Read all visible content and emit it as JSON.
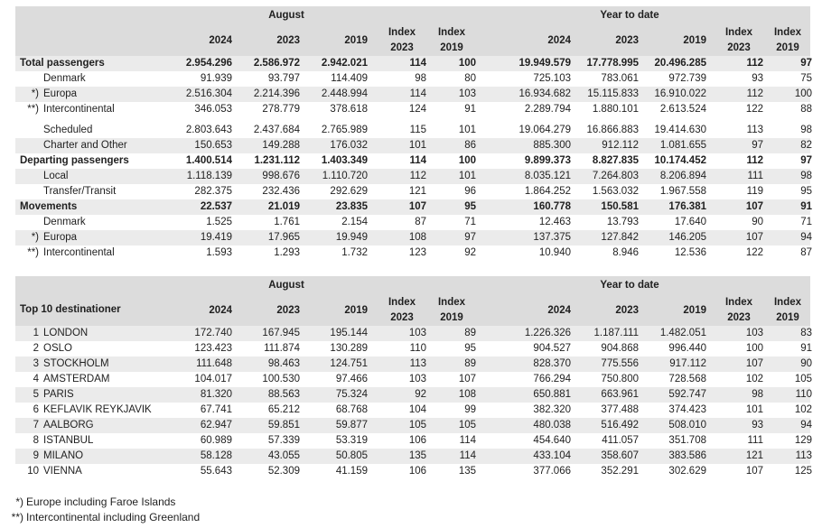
{
  "traffic": {
    "header": {
      "group_august": "August",
      "group_ytd": "Year to date",
      "col_2024": "2024",
      "col_2023": "2023",
      "col_2019": "2019",
      "index_label": "Index",
      "index_2023": "2023",
      "index_2019": "2019"
    },
    "rows": [
      {
        "label": "Total passengers",
        "mark": "",
        "bold": true,
        "shade": true,
        "aug": [
          "2.954.296",
          "2.586.972",
          "2.942.021",
          "114",
          "100"
        ],
        "ytd": [
          "19.949.579",
          "17.778.995",
          "20.496.285",
          "112",
          "97"
        ]
      },
      {
        "label": "Denmark",
        "mark": "",
        "bold": false,
        "shade": false,
        "aug": [
          "91.939",
          "93.797",
          "114.409",
          "98",
          "80"
        ],
        "ytd": [
          "725.103",
          "783.061",
          "972.739",
          "93",
          "75"
        ]
      },
      {
        "label": "Europa",
        "mark": "*)",
        "bold": false,
        "shade": true,
        "aug": [
          "2.516.304",
          "2.214.396",
          "2.448.994",
          "114",
          "103"
        ],
        "ytd": [
          "16.934.682",
          "15.115.833",
          "16.910.022",
          "112",
          "100"
        ]
      },
      {
        "label": "Intercontinental",
        "mark": "**)",
        "bold": false,
        "shade": false,
        "aug": [
          "346.053",
          "278.779",
          "378.618",
          "124",
          "91"
        ],
        "ytd": [
          "2.289.794",
          "1.880.101",
          "2.613.524",
          "122",
          "88"
        ]
      },
      {
        "gap": true
      },
      {
        "label": "Scheduled",
        "mark": "",
        "bold": false,
        "shade": false,
        "aug": [
          "2.803.643",
          "2.437.684",
          "2.765.989",
          "115",
          "101"
        ],
        "ytd": [
          "19.064.279",
          "16.866.883",
          "19.414.630",
          "113",
          "98"
        ]
      },
      {
        "label": "Charter and Other",
        "mark": "",
        "bold": false,
        "shade": true,
        "aug": [
          "150.653",
          "149.288",
          "176.032",
          "101",
          "86"
        ],
        "ytd": [
          "885.300",
          "912.112",
          "1.081.655",
          "97",
          "82"
        ]
      },
      {
        "label": "Departing passengers",
        "mark": "",
        "bold": true,
        "shade": false,
        "aug": [
          "1.400.514",
          "1.231.112",
          "1.403.349",
          "114",
          "100"
        ],
        "ytd": [
          "9.899.373",
          "8.827.835",
          "10.174.452",
          "112",
          "97"
        ]
      },
      {
        "label": "Local",
        "mark": "",
        "bold": false,
        "shade": true,
        "aug": [
          "1.118.139",
          "998.676",
          "1.110.720",
          "112",
          "101"
        ],
        "ytd": [
          "8.035.121",
          "7.264.803",
          "8.206.894",
          "111",
          "98"
        ]
      },
      {
        "label": "Transfer/Transit",
        "mark": "",
        "bold": false,
        "shade": false,
        "aug": [
          "282.375",
          "232.436",
          "292.629",
          "121",
          "96"
        ],
        "ytd": [
          "1.864.252",
          "1.563.032",
          "1.967.558",
          "119",
          "95"
        ]
      },
      {
        "label": "Movements",
        "mark": "",
        "bold": true,
        "shade": true,
        "aug": [
          "22.537",
          "21.019",
          "23.835",
          "107",
          "95"
        ],
        "ytd": [
          "160.778",
          "150.581",
          "176.381",
          "107",
          "91"
        ]
      },
      {
        "label": "Denmark",
        "mark": "",
        "bold": false,
        "shade": false,
        "aug": [
          "1.525",
          "1.761",
          "2.154",
          "87",
          "71"
        ],
        "ytd": [
          "12.463",
          "13.793",
          "17.640",
          "90",
          "71"
        ]
      },
      {
        "label": "Europa",
        "mark": "*)",
        "bold": false,
        "shade": true,
        "aug": [
          "19.419",
          "17.965",
          "19.949",
          "108",
          "97"
        ],
        "ytd": [
          "137.375",
          "127.842",
          "146.205",
          "107",
          "94"
        ]
      },
      {
        "label": "Intercontinental",
        "mark": "**)",
        "bold": false,
        "shade": false,
        "aug": [
          "1.593",
          "1.293",
          "1.732",
          "123",
          "92"
        ],
        "ytd": [
          "10.940",
          "8.946",
          "12.536",
          "122",
          "87"
        ]
      }
    ]
  },
  "destinations": {
    "header": {
      "title": "Top 10 destinationer",
      "group_august": "August",
      "group_ytd": "Year to date",
      "col_2024": "2024",
      "col_2023": "2023",
      "col_2019": "2019",
      "index_label": "Index",
      "index_2023": "2023",
      "index_2019": "2019"
    },
    "rows": [
      {
        "rank": "1",
        "label": "LONDON",
        "aug": [
          "172.740",
          "167.945",
          "195.144",
          "103",
          "89"
        ],
        "ytd": [
          "1.226.326",
          "1.187.111",
          "1.482.051",
          "103",
          "83"
        ]
      },
      {
        "rank": "2",
        "label": "OSLO",
        "aug": [
          "123.423",
          "111.874",
          "130.289",
          "110",
          "95"
        ],
        "ytd": [
          "904.527",
          "904.868",
          "996.440",
          "100",
          "91"
        ]
      },
      {
        "rank": "3",
        "label": "STOCKHOLM",
        "aug": [
          "111.648",
          "98.463",
          "124.751",
          "113",
          "89"
        ],
        "ytd": [
          "828.370",
          "775.556",
          "917.112",
          "107",
          "90"
        ]
      },
      {
        "rank": "4",
        "label": "AMSTERDAM",
        "aug": [
          "104.017",
          "100.530",
          "97.466",
          "103",
          "107"
        ],
        "ytd": [
          "766.294",
          "750.800",
          "728.568",
          "102",
          "105"
        ]
      },
      {
        "rank": "5",
        "label": "PARIS",
        "aug": [
          "81.320",
          "88.563",
          "75.324",
          "92",
          "108"
        ],
        "ytd": [
          "650.881",
          "663.961",
          "592.747",
          "98",
          "110"
        ]
      },
      {
        "rank": "6",
        "label": "KEFLAVIK REYKJAVIK",
        "aug": [
          "67.741",
          "65.212",
          "68.768",
          "104",
          "99"
        ],
        "ytd": [
          "382.320",
          "377.488",
          "374.423",
          "101",
          "102"
        ]
      },
      {
        "rank": "7",
        "label": "AALBORG",
        "aug": [
          "62.947",
          "59.851",
          "59.877",
          "105",
          "105"
        ],
        "ytd": [
          "480.038",
          "516.492",
          "508.010",
          "93",
          "94"
        ]
      },
      {
        "rank": "8",
        "label": "ISTANBUL",
        "aug": [
          "60.989",
          "57.339",
          "53.319",
          "106",
          "114"
        ],
        "ytd": [
          "454.640",
          "411.057",
          "351.708",
          "111",
          "129"
        ]
      },
      {
        "rank": "9",
        "label": "MILANO",
        "aug": [
          "58.128",
          "43.055",
          "50.805",
          "135",
          "114"
        ],
        "ytd": [
          "433.104",
          "358.607",
          "383.586",
          "121",
          "113"
        ]
      },
      {
        "rank": "10",
        "label": "VIENNA",
        "aug": [
          "55.643",
          "52.309",
          "41.159",
          "106",
          "135"
        ],
        "ytd": [
          "377.066",
          "352.291",
          "302.629",
          "107",
          "125"
        ]
      }
    ]
  },
  "footnotes": [
    {
      "mark": "*)",
      "text": "Europe including Faroe Islands"
    },
    {
      "mark": "**)",
      "text": "Intercontinental including Greenland"
    }
  ],
  "colors": {
    "header_bg": "#dcdcdc",
    "row_shade": "#ebebeb",
    "text": "#1f1f1f"
  }
}
